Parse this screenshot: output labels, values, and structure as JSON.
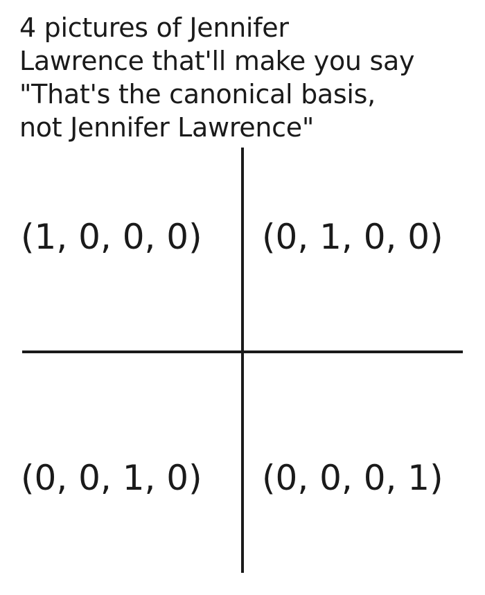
{
  "title": {
    "lines": [
      "4 pictures of Jennifer",
      "Lawrence that'll make you say",
      "\"That's the canonical basis,",
      "not Jennifer Lawrence\""
    ]
  },
  "grid": {
    "top_left": "(1, 0, 0, 0)",
    "top_right": "(0, 1, 0, 0)",
    "bottom_left": "(0, 0, 1, 0)",
    "bottom_right": "(0, 0, 0, 1)"
  },
  "colors": {
    "background": "#ffffff",
    "text": "#1a1a1a",
    "lines": "#1a1a1a"
  }
}
